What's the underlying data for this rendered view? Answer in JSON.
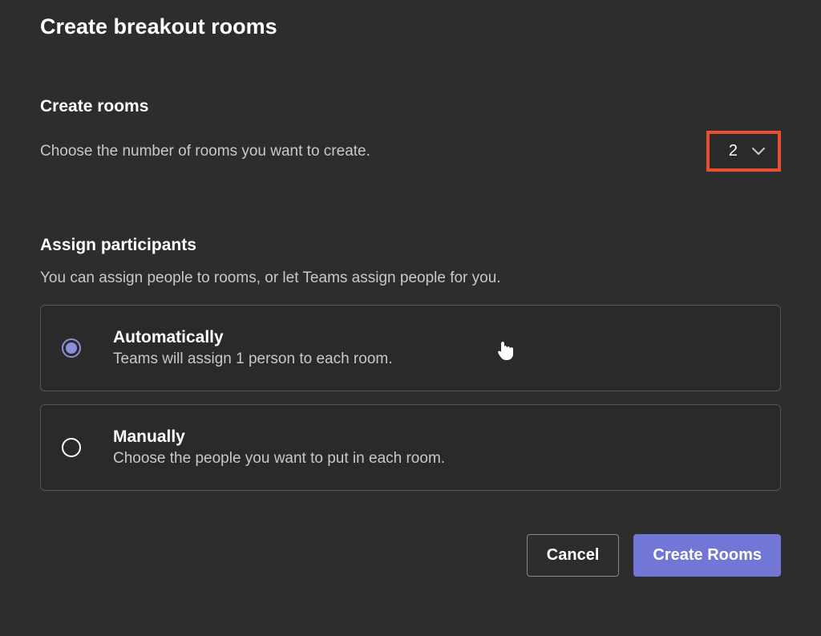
{
  "dialog": {
    "title": "Create breakout rooms"
  },
  "createRooms": {
    "sectionTitle": "Create rooms",
    "description": "Choose the number of rooms you want to create.",
    "selectedCount": "2"
  },
  "assignParticipants": {
    "sectionTitle": "Assign participants",
    "description": "You can assign people to rooms, or let Teams assign people for you."
  },
  "options": {
    "automatically": {
      "title": "Automatically",
      "description": "Teams will assign 1 person to each room."
    },
    "manually": {
      "title": "Manually",
      "description": "Choose the people you want to put in each room."
    }
  },
  "buttons": {
    "cancel": "Cancel",
    "create": "Create Rooms"
  }
}
